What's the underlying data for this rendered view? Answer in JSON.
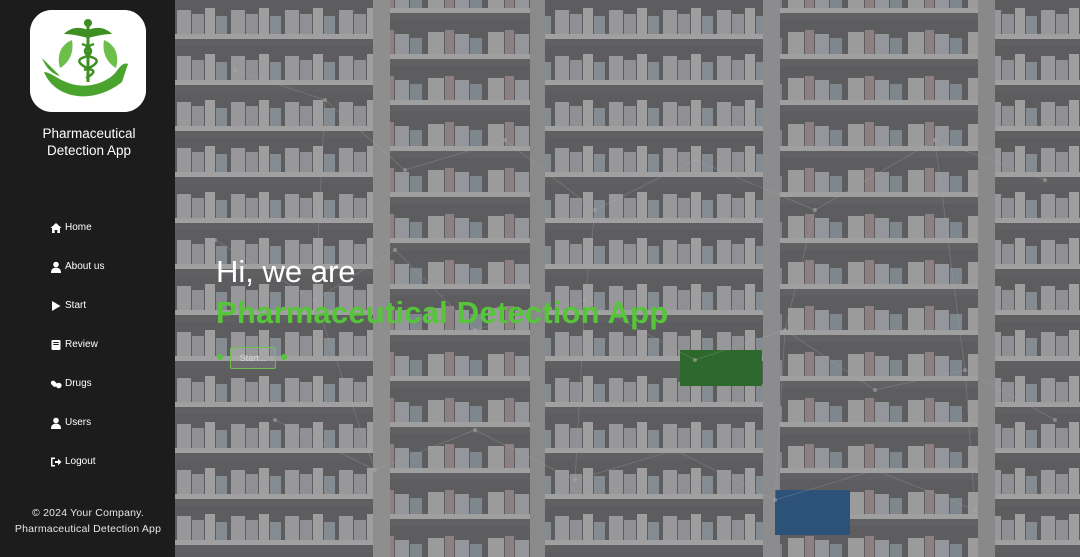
{
  "app": {
    "title_line1": "Pharmaceutical",
    "title_line2": "Detection App"
  },
  "sidebar": {
    "items": [
      {
        "label": "Home",
        "icon": "home-icon"
      },
      {
        "label": "About us",
        "icon": "user-icon"
      },
      {
        "label": "Start",
        "icon": "play-icon"
      },
      {
        "label": "Review",
        "icon": "book-icon"
      },
      {
        "label": "Drugs",
        "icon": "pills-icon"
      },
      {
        "label": "Users",
        "icon": "user-icon"
      },
      {
        "label": "Logout",
        "icon": "logout-icon"
      }
    ]
  },
  "footer": {
    "line1": "© 2024 Your Company.",
    "line2": "Pharmaceutical Detection App"
  },
  "hero": {
    "greeting": "Hi, we are",
    "headline": "Pharmaceutical Detection App",
    "start_label": "Start..."
  },
  "colors": {
    "accent_green": "#56c53a",
    "sidebar_bg": "#1c1c1c"
  }
}
